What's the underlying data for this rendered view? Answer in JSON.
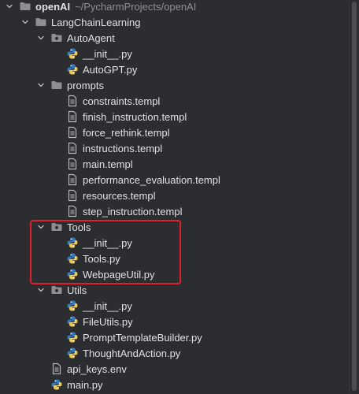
{
  "tree": [
    {
      "kind": "root-folder",
      "name": "openAI",
      "path": "~/PycharmProjects/openAI",
      "expanded": true,
      "depth": 0
    },
    {
      "kind": "folder",
      "name": "LangChainLearning",
      "expanded": true,
      "depth": 1
    },
    {
      "kind": "package",
      "name": "AutoAgent",
      "expanded": true,
      "depth": 2
    },
    {
      "kind": "python",
      "name": "__init__.py",
      "depth": 3
    },
    {
      "kind": "python",
      "name": "AutoGPT.py",
      "depth": 3
    },
    {
      "kind": "folder",
      "name": "prompts",
      "expanded": true,
      "depth": 2
    },
    {
      "kind": "text",
      "name": "constraints.templ",
      "depth": 3
    },
    {
      "kind": "text",
      "name": "finish_instruction.templ",
      "depth": 3
    },
    {
      "kind": "text",
      "name": "force_rethink.templ",
      "depth": 3
    },
    {
      "kind": "text",
      "name": "instructions.templ",
      "depth": 3
    },
    {
      "kind": "text",
      "name": "main.templ",
      "depth": 3
    },
    {
      "kind": "text",
      "name": "performance_evaluation.templ",
      "depth": 3
    },
    {
      "kind": "text",
      "name": "resources.templ",
      "depth": 3
    },
    {
      "kind": "text",
      "name": "step_instruction.templ",
      "depth": 3
    },
    {
      "kind": "package",
      "name": "Tools",
      "expanded": true,
      "depth": 2
    },
    {
      "kind": "python",
      "name": "__init__.py",
      "depth": 3
    },
    {
      "kind": "python",
      "name": "Tools.py",
      "depth": 3
    },
    {
      "kind": "python",
      "name": "WebpageUtil.py",
      "depth": 3
    },
    {
      "kind": "package",
      "name": "Utils",
      "expanded": true,
      "depth": 2
    },
    {
      "kind": "python",
      "name": "__init__.py",
      "depth": 3
    },
    {
      "kind": "python",
      "name": "FileUtils.py",
      "depth": 3
    },
    {
      "kind": "python",
      "name": "PromptTemplateBuilder.py",
      "depth": 3
    },
    {
      "kind": "python",
      "name": "ThoughtAndAction.py",
      "depth": 3
    },
    {
      "kind": "text",
      "name": "api_keys.env",
      "depth": 2
    },
    {
      "kind": "python",
      "name": "main.py",
      "depth": 2
    }
  ],
  "highlight": {
    "color": "#e0202a",
    "items": [
      "Tools",
      "__init__.py",
      "Tools.py",
      "WebpageUtil.py"
    ]
  },
  "colors": {
    "background": "#2b2d30",
    "text": "#dfe1e5",
    "muted": "#8c8f94",
    "folder": "#8c8f94",
    "python_blue": "#3d7ab8",
    "python_yellow": "#f2c94c"
  }
}
